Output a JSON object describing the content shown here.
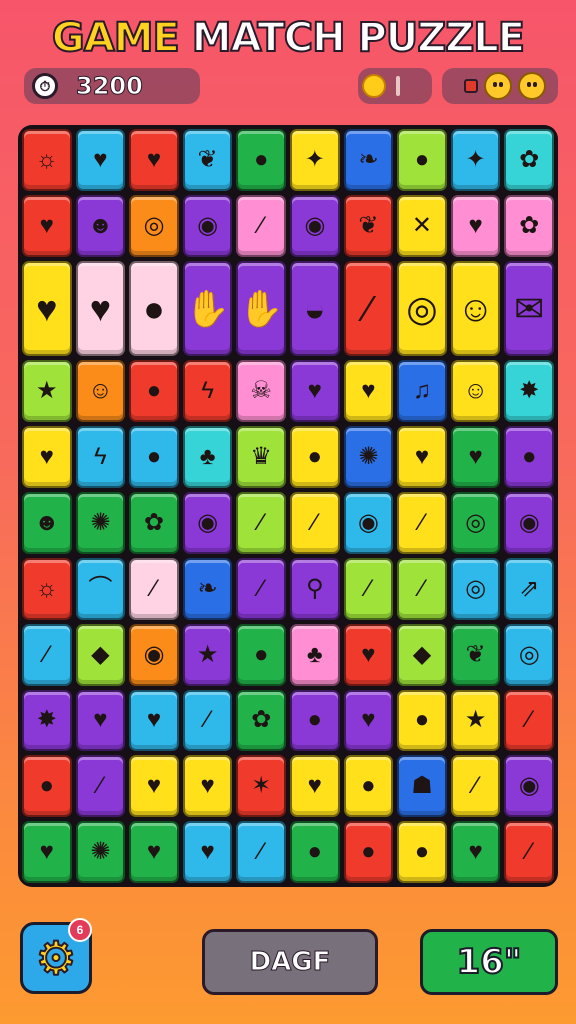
{
  "header": {
    "title_word1": "GAME",
    "title_word2": "MATCH PUZZLE"
  },
  "hud": {
    "clock_icon": "clock-icon",
    "score": "3200",
    "sun_icon": "sun-icon",
    "faces": [
      "smiley-face-icon",
      "smiley-face-icon"
    ]
  },
  "colors": {
    "R": "#f03a2c",
    "O": "#fb8c1a",
    "Y": "#ffe01a",
    "L": "#9ee23a",
    "G": "#22b24a",
    "C": "#2fb8ea",
    "B": "#2a6fe6",
    "P": "#8a38d6",
    "K": "#ff8fd2",
    "k": "#ffd3e4",
    "T": "#36d4d6"
  },
  "board": {
    "columns": 10,
    "rows": [
      {
        "tall": false,
        "tiles": [
          {
            "c": "R",
            "i": "sun-icon",
            "g": "☼"
          },
          {
            "c": "C",
            "i": "heart-icon",
            "g": "♥"
          },
          {
            "c": "R",
            "i": "apple-icon",
            "g": "♥"
          },
          {
            "c": "C",
            "i": "leaf-icon",
            "g": "❦"
          },
          {
            "c": "G",
            "i": "apple-icon",
            "g": "●"
          },
          {
            "c": "Y",
            "i": "pepper-icon",
            "g": "✦"
          },
          {
            "c": "B",
            "i": "leaf-icon",
            "g": "❧"
          },
          {
            "c": "L",
            "i": "apple-icon",
            "g": "●"
          },
          {
            "c": "C",
            "i": "star-icon",
            "g": "✦"
          },
          {
            "c": "T",
            "i": "flower-icon",
            "g": "✿"
          }
        ]
      },
      {
        "tall": false,
        "tiles": [
          {
            "c": "R",
            "i": "strawberry-icon",
            "g": "♥"
          },
          {
            "c": "P",
            "i": "mushroom-icon",
            "g": "☻"
          },
          {
            "c": "O",
            "i": "donut-icon",
            "g": "◎"
          },
          {
            "c": "P",
            "i": "eye-icon",
            "g": "◉"
          },
          {
            "c": "K",
            "i": "carrot-icon",
            "g": "⁄"
          },
          {
            "c": "P",
            "i": "lips-icon",
            "g": "◉"
          },
          {
            "c": "R",
            "i": "cactus-icon",
            "g": "❦"
          },
          {
            "c": "Y",
            "i": "cross-icon",
            "g": "✕"
          },
          {
            "c": "K",
            "i": "heart-icon",
            "g": "♥"
          },
          {
            "c": "K",
            "i": "gear-icon",
            "g": "✿"
          }
        ]
      },
      {
        "tall": true,
        "tiles": [
          {
            "c": "Y",
            "i": "fruit-icon",
            "g": "♥"
          },
          {
            "c": "k",
            "i": "balloon-icon",
            "g": "♥"
          },
          {
            "c": "k",
            "i": "balloon-icon",
            "g": "●"
          },
          {
            "c": "P",
            "i": "hand-icon",
            "g": "✋"
          },
          {
            "c": "P",
            "i": "hand-icon",
            "g": "✋"
          },
          {
            "c": "P",
            "i": "sushi-icon",
            "g": "◒"
          },
          {
            "c": "R",
            "i": "pickle-icon",
            "g": "⁄"
          },
          {
            "c": "Y",
            "i": "snail-icon",
            "g": "◎"
          },
          {
            "c": "Y",
            "i": "doll-icon",
            "g": "☺"
          },
          {
            "c": "P",
            "i": "envelope-icon",
            "g": "✉"
          }
        ]
      },
      {
        "tall": false,
        "tiles": [
          {
            "c": "L",
            "i": "star-icon",
            "g": "★"
          },
          {
            "c": "O",
            "i": "smiley-icon",
            "g": "☺"
          },
          {
            "c": "R",
            "i": "apple-icon",
            "g": "●"
          },
          {
            "c": "R",
            "i": "lightning-icon",
            "g": "ϟ"
          },
          {
            "c": "K",
            "i": "skull-icon",
            "g": "☠"
          },
          {
            "c": "P",
            "i": "heart-icon",
            "g": "♥"
          },
          {
            "c": "Y",
            "i": "heart-icon",
            "g": "♥"
          },
          {
            "c": "B",
            "i": "music-note-icon",
            "g": "♫"
          },
          {
            "c": "Y",
            "i": "smiley-icon",
            "g": "☺"
          },
          {
            "c": "T",
            "i": "leaf-icon",
            "g": "✸"
          }
        ]
      },
      {
        "tall": false,
        "tiles": [
          {
            "c": "Y",
            "i": "heart-icon",
            "g": "♥"
          },
          {
            "c": "C",
            "i": "lightning-icon",
            "g": "ϟ"
          },
          {
            "c": "C",
            "i": "lemon-icon",
            "g": "●"
          },
          {
            "c": "T",
            "i": "tree-icon",
            "g": "♣"
          },
          {
            "c": "L",
            "i": "crown-icon",
            "g": "♛"
          },
          {
            "c": "Y",
            "i": "apple-icon",
            "g": "●"
          },
          {
            "c": "B",
            "i": "berry-icon",
            "g": "✺"
          },
          {
            "c": "Y",
            "i": "heart-icon",
            "g": "♥"
          },
          {
            "c": "G",
            "i": "heart-icon",
            "g": "♥"
          },
          {
            "c": "P",
            "i": "lemon-icon",
            "g": "●"
          }
        ]
      },
      {
        "tall": false,
        "tiles": [
          {
            "c": "G",
            "i": "bear-icon",
            "g": "☻"
          },
          {
            "c": "G",
            "i": "cookie-icon",
            "g": "✺"
          },
          {
            "c": "G",
            "i": "flower-icon",
            "g": "✿"
          },
          {
            "c": "P",
            "i": "speech-bubble-icon",
            "g": "◉"
          },
          {
            "c": "L",
            "i": "carrot-icon",
            "g": "⁄"
          },
          {
            "c": "Y",
            "i": "carrot-icon",
            "g": "⁄"
          },
          {
            "c": "C",
            "i": "speech-bubble-icon",
            "g": "◉"
          },
          {
            "c": "Y",
            "i": "chili-icon",
            "g": "⁄"
          },
          {
            "c": "G",
            "i": "lemon-icon",
            "g": "◎"
          },
          {
            "c": "P",
            "i": "speech-bubble-icon",
            "g": "◉"
          }
        ]
      },
      {
        "tall": false,
        "tiles": [
          {
            "c": "R",
            "i": "smiley-icon",
            "g": "☼"
          },
          {
            "c": "C",
            "i": "bird-icon",
            "g": "⌒"
          },
          {
            "c": "k",
            "i": "leaf-icon",
            "g": "⁄"
          },
          {
            "c": "B",
            "i": "leaf-icon",
            "g": "❧"
          },
          {
            "c": "P",
            "i": "carrot-icon",
            "g": "⁄"
          },
          {
            "c": "P",
            "i": "magnifier-icon",
            "g": "⚲"
          },
          {
            "c": "L",
            "i": "carrot-icon",
            "g": "⁄"
          },
          {
            "c": "L",
            "i": "carrot-icon",
            "g": "⁄"
          },
          {
            "c": "C",
            "i": "lemon-icon",
            "g": "◎"
          },
          {
            "c": "C",
            "i": "rocket-icon",
            "g": "⇗"
          }
        ]
      },
      {
        "tall": false,
        "tiles": [
          {
            "c": "C",
            "i": "feather-icon",
            "g": "⁄"
          },
          {
            "c": "L",
            "i": "cheese-icon",
            "g": "◆"
          },
          {
            "c": "O",
            "i": "eye-icon",
            "g": "◉"
          },
          {
            "c": "P",
            "i": "star-icon",
            "g": "★"
          },
          {
            "c": "G",
            "i": "apple-icon",
            "g": "●"
          },
          {
            "c": "K",
            "i": "plant-icon",
            "g": "♣"
          },
          {
            "c": "R",
            "i": "heart-icon",
            "g": "♥"
          },
          {
            "c": "L",
            "i": "cheese-icon",
            "g": "◆"
          },
          {
            "c": "G",
            "i": "speech-bubble-icon",
            "g": "❦"
          },
          {
            "c": "C",
            "i": "donut-icon",
            "g": "◎"
          }
        ]
      },
      {
        "tall": false,
        "tiles": [
          {
            "c": "P",
            "i": "splash-icon",
            "g": "✸"
          },
          {
            "c": "P",
            "i": "heart-icon",
            "g": "♥"
          },
          {
            "c": "C",
            "i": "heart-icon",
            "g": "♥"
          },
          {
            "c": "C",
            "i": "feather-icon",
            "g": "⁄"
          },
          {
            "c": "G",
            "i": "flower-icon",
            "g": "✿"
          },
          {
            "c": "P",
            "i": "tomato-icon",
            "g": "●"
          },
          {
            "c": "P",
            "i": "heart-icon",
            "g": "♥"
          },
          {
            "c": "Y",
            "i": "strawberry-icon",
            "g": "●"
          },
          {
            "c": "Y",
            "i": "star-icon",
            "g": "★"
          },
          {
            "c": "R",
            "i": "feather-icon",
            "g": "⁄"
          }
        ]
      },
      {
        "tall": false,
        "tiles": [
          {
            "c": "R",
            "i": "strawberry-icon",
            "g": "●"
          },
          {
            "c": "P",
            "i": "pickle-icon",
            "g": "⁄"
          },
          {
            "c": "Y",
            "i": "apple-icon",
            "g": "♥"
          },
          {
            "c": "Y",
            "i": "apple-icon",
            "g": "♥"
          },
          {
            "c": "R",
            "i": "spark-icon",
            "g": "✶"
          },
          {
            "c": "Y",
            "i": "heart-icon",
            "g": "♥"
          },
          {
            "c": "Y",
            "i": "apple-icon",
            "g": "●"
          },
          {
            "c": "B",
            "i": "ghost-icon",
            "g": "☗"
          },
          {
            "c": "Y",
            "i": "bottle-icon",
            "g": "⁄"
          },
          {
            "c": "P",
            "i": "speech-bubble-icon",
            "g": "◉"
          }
        ]
      },
      {
        "tall": false,
        "tiles": [
          {
            "c": "G",
            "i": "heart-icon",
            "g": "♥"
          },
          {
            "c": "G",
            "i": "cookie-icon",
            "g": "✺"
          },
          {
            "c": "G",
            "i": "heart-icon",
            "g": "♥"
          },
          {
            "c": "C",
            "i": "heart-icon",
            "g": "♥"
          },
          {
            "c": "C",
            "i": "bandage-icon",
            "g": "⁄"
          },
          {
            "c": "G",
            "i": "plum-icon",
            "g": "●"
          },
          {
            "c": "R",
            "i": "tomato-icon",
            "g": "●"
          },
          {
            "c": "Y",
            "i": "strawberry-icon",
            "g": "●"
          },
          {
            "c": "G",
            "i": "heart-icon",
            "g": "♥"
          },
          {
            "c": "R",
            "i": "feather-icon",
            "g": "⁄"
          }
        ]
      }
    ]
  },
  "footer": {
    "settings_icon": "gear-icon",
    "badge_text": "6",
    "button_label": "DAGF",
    "timer": "16\""
  }
}
